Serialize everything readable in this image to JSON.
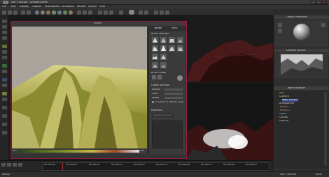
{
  "titlebar": {
    "title": "Vue 9 Infinite - Untitled scene"
  },
  "menu": [
    "File",
    "Edit",
    "Display",
    "Objects",
    "Atmosphere",
    "Animation",
    "Render",
    "Python",
    "Help"
  ],
  "sculpt": {
    "title": "Sculpt",
    "gradient_left": "0m",
    "gradient_right": "100m"
  },
  "brush_panel": {
    "tabs": [
      "Brush",
      "Paint"
    ],
    "brush_settings": "Brush settings",
    "brush_mode": "Brush mode",
    "global_settings": "Global settings",
    "rows": [
      "Radius",
      "Flow",
      "Falloff"
    ],
    "constrain": "Constrain to altitude range",
    "materials": "Materials"
  },
  "right_panel": {
    "object_properties": "Object Properties",
    "camera_control": "Camera Control",
    "world_browser": "World Browser",
    "tree": [
      "Sun",
      "Camera",
      "Main camera",
      "Atmosphere",
      "Terrain 1",
      "Terrain 2",
      "Water",
      "Clouds",
      "Ground"
    ]
  },
  "timeline": {
    "marks": [
      "00:00:00",
      "00:00:01",
      "00:00:02",
      "00:00:03",
      "00:00:04",
      "00:00:05",
      "00:00:06",
      "00:00:07",
      "00:00:08",
      "00:00:09"
    ]
  },
  "status": {
    "left": "Ready",
    "right": "Vue 9 Infinite",
    "count": "100%"
  },
  "colors": {
    "accent": "#8a1c3c",
    "terrain_dark": "#3a3a12",
    "terrain_light": "#c9c46a"
  }
}
